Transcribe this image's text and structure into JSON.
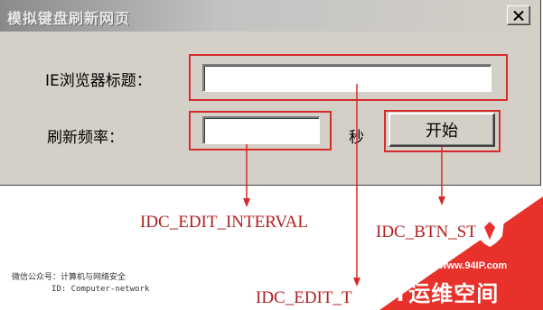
{
  "window": {
    "title": "模拟键盘刷新网页"
  },
  "form": {
    "title_label": "IE浏览器标题：",
    "title_value": "",
    "interval_label": "刷新频率：",
    "interval_value": "",
    "unit_label": "秒",
    "start_button": "开始"
  },
  "annotations": {
    "interval_id": "IDC_EDIT_INTERVAL",
    "button_id": "IDC_BTN_ST",
    "title_id": "IDC_EDIT_T"
  },
  "footer": {
    "line1": "微信公众号：计算机与网络安全",
    "line2": "ID: Computer-network"
  },
  "watermark": {
    "url": "www.94IP.com",
    "brand": "IT运维空间"
  },
  "colors": {
    "dialog_face": "#d4d0c8",
    "annotation_red": "#d62b2b",
    "watermark_red": "#e8312a"
  }
}
